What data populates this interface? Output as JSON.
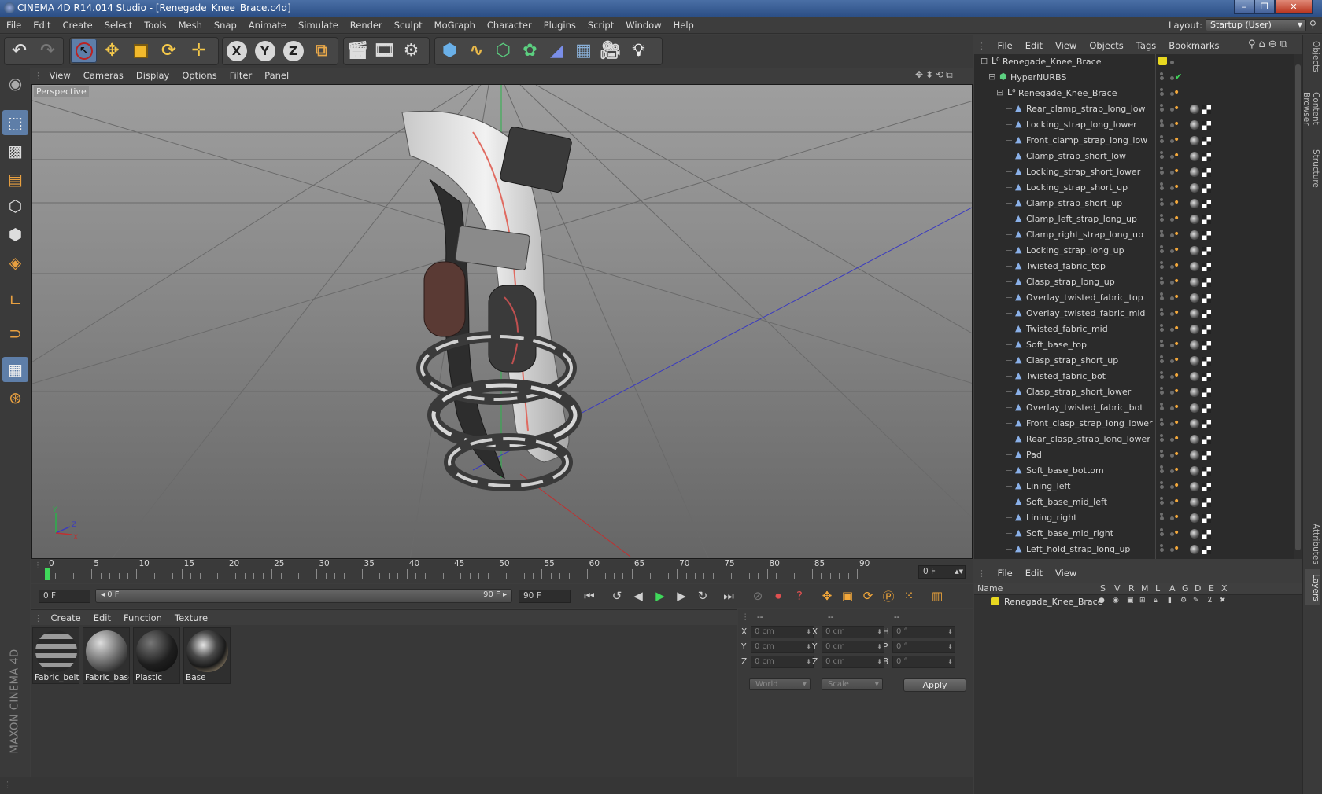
{
  "window": {
    "title": "CINEMA 4D R14.014 Studio - [Renegade_Knee_Brace.c4d]",
    "buttons": {
      "minimize": "‒",
      "maximize": "❐",
      "close": "✕"
    }
  },
  "menubar": [
    "File",
    "Edit",
    "Create",
    "Select",
    "Tools",
    "Mesh",
    "Snap",
    "Animate",
    "Simulate",
    "Render",
    "Sculpt",
    "MoGraph",
    "Character",
    "Plugins",
    "Script",
    "Window",
    "Help"
  ],
  "layout": {
    "label": "Layout:",
    "value": "Startup (User)"
  },
  "viewport": {
    "menu": [
      "View",
      "Cameras",
      "Display",
      "Options",
      "Filter",
      "Panel"
    ],
    "label": "Perspective",
    "axis": {
      "y": "Y",
      "z": "Z",
      "x": "X"
    }
  },
  "timeline": {
    "ticks": [
      "0",
      "5",
      "10",
      "15",
      "20",
      "25",
      "30",
      "35",
      "40",
      "45",
      "50",
      "55",
      "60",
      "65",
      "70",
      "75",
      "80",
      "85",
      "90"
    ],
    "current_frame": "0 F",
    "start_field": "0 F",
    "range_start": "◂ 0 F",
    "range_end": "90 F ▸",
    "end_field": "90 F",
    "playhead_frame": 0,
    "frame_max": 90
  },
  "material_manager": {
    "menu": [
      "Create",
      "Edit",
      "Function",
      "Texture"
    ],
    "materials": [
      {
        "name": "Fabric_belt",
        "style": "belt"
      },
      {
        "name": "Fabric_base",
        "style": "base"
      },
      {
        "name": "Plastic",
        "style": "plastic"
      },
      {
        "name": "Base",
        "style": "chrome"
      }
    ]
  },
  "coordinates": {
    "headers": [
      "--",
      "--",
      "--"
    ],
    "position": [
      {
        "axis": "X",
        "value": "0 cm"
      },
      {
        "axis": "Y",
        "value": "0 cm"
      },
      {
        "axis": "Z",
        "value": "0 cm"
      }
    ],
    "size": [
      {
        "axis": "X",
        "value": "0 cm"
      },
      {
        "axis": "Y",
        "value": "0 cm"
      },
      {
        "axis": "Z",
        "value": "0 cm"
      }
    ],
    "rotation": [
      {
        "axis": "H",
        "value": "0 °"
      },
      {
        "axis": "P",
        "value": "0 °"
      },
      {
        "axis": "B",
        "value": "0 °"
      }
    ],
    "space_dropdown": "World",
    "mode_dropdown": "Scale",
    "apply_label": "Apply"
  },
  "object_manager": {
    "menu": [
      "File",
      "Edit",
      "View",
      "Objects",
      "Tags",
      "Bookmarks"
    ],
    "root": "Renegade_Knee_Brace",
    "nurbs": "HyperNURBS",
    "group": "Renegade_Knee_Brace",
    "children": [
      "Rear_clamp_strap_long_low",
      "Locking_strap_long_lower",
      "Front_clamp_strap_long_low",
      "Clamp_strap_short_low",
      "Locking_strap_short_lower",
      "Locking_strap_short_up",
      "Clamp_strap_short_up",
      "Clamp_left_strap_long_up",
      "Clamp_right_strap_long_up",
      "Locking_strap_long_up",
      "Twisted_fabric_top",
      "Clasp_strap_long_up",
      "Overlay_twisted_fabric_top",
      "Overlay_twisted_fabric_mid",
      "Twisted_fabric_mid",
      "Soft_base_top",
      "Clasp_strap_short_up",
      "Twisted_fabric_bot",
      "Clasp_strap_short_lower",
      "Overlay_twisted_fabric_bot",
      "Front_clasp_strap_long_lower",
      "Rear_clasp_strap_long_lower",
      "Pad",
      "Soft_base_bottom",
      "Lining_left",
      "Soft_base_mid_left",
      "Lining_right",
      "Soft_base_mid_right",
      "Left_hold_strap_long_up"
    ]
  },
  "layer_manager": {
    "menu": [
      "File",
      "Edit",
      "View"
    ],
    "columns": [
      "Name",
      "S",
      "V",
      "R",
      "M",
      "L",
      "A",
      "G",
      "D",
      "E",
      "X"
    ],
    "layers": [
      {
        "name": "Renegade_Knee_Brace",
        "color": "#e8d820"
      }
    ]
  },
  "right_tabs": [
    "Objects",
    "Content Browser",
    "Structure",
    "Attributes",
    "Layers"
  ],
  "brand": "MAXON CINEMA 4D",
  "colors": {
    "accent": "#5e7ea8",
    "panel": "#3d3d3d",
    "layer_yellow": "#e8d820",
    "timeline_green": "#3fd85a"
  }
}
